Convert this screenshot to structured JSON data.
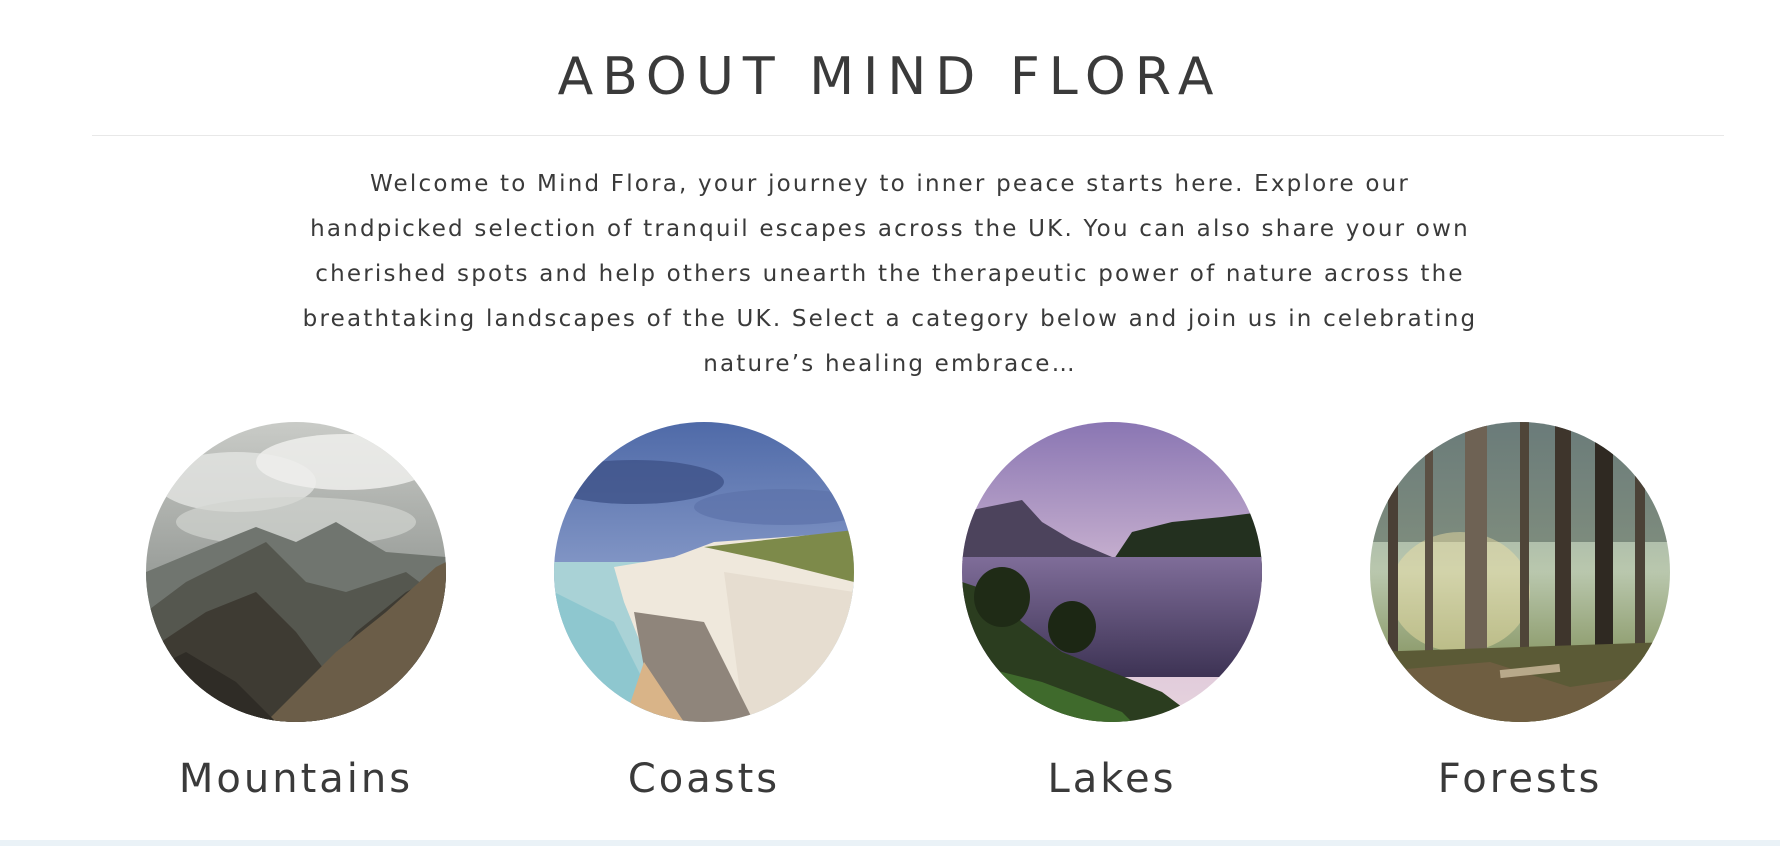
{
  "about": {
    "title": "ABOUT MIND FLORA",
    "intro": "Welcome to Mind Flora, your journey to inner peace starts here. Explore our handpicked selection of tranquil escapes across the UK. You can also share your own cherished spots and help others unearth the therapeutic power of nature across the breathtaking landscapes of the UK. Select a category below and join us in celebrating nature’s healing embrace…"
  },
  "categories": [
    {
      "label": "Mountains",
      "image": "mountain-range-photo"
    },
    {
      "label": "Coasts",
      "image": "white-cliffs-beach-photo"
    },
    {
      "label": "Lakes",
      "image": "lake-at-dusk-photo"
    },
    {
      "label": "Forests",
      "image": "pine-forest-photo"
    }
  ]
}
